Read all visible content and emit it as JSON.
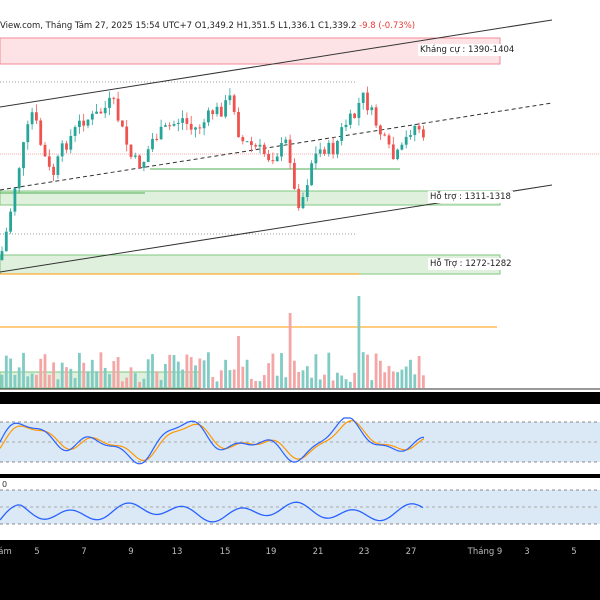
{
  "header": {
    "source": "View.com, Tháng Tám 27, 2025 15:54 UTC+7",
    "open": "O1,349.2",
    "high": "H1,351.5",
    "low": "L1,336.1",
    "close": "C1,339.2",
    "change": "-9.8 (-0.73%)"
  },
  "zones": {
    "resistance": "Kháng cự : 1390-1404",
    "support1": "Hỗ trợ : 1311-1318",
    "support2": "Hỗ Trợ : 1272-1282"
  },
  "rsi": {
    "zero_label": "0"
  },
  "time_axis": [
    "ám",
    "5",
    "7",
    "9",
    "13",
    "15",
    "19",
    "21",
    "23",
    "27",
    "Tháng 9",
    "3",
    "5"
  ],
  "colors": {
    "bull": "#26a69a",
    "bear": "#ef5350",
    "zone_red": "#f28b94",
    "zone_green": "#7fc77f",
    "stoch_k": "#2962ff",
    "stoch_d": "#ff9800",
    "rsi": "#2962ff"
  }
}
